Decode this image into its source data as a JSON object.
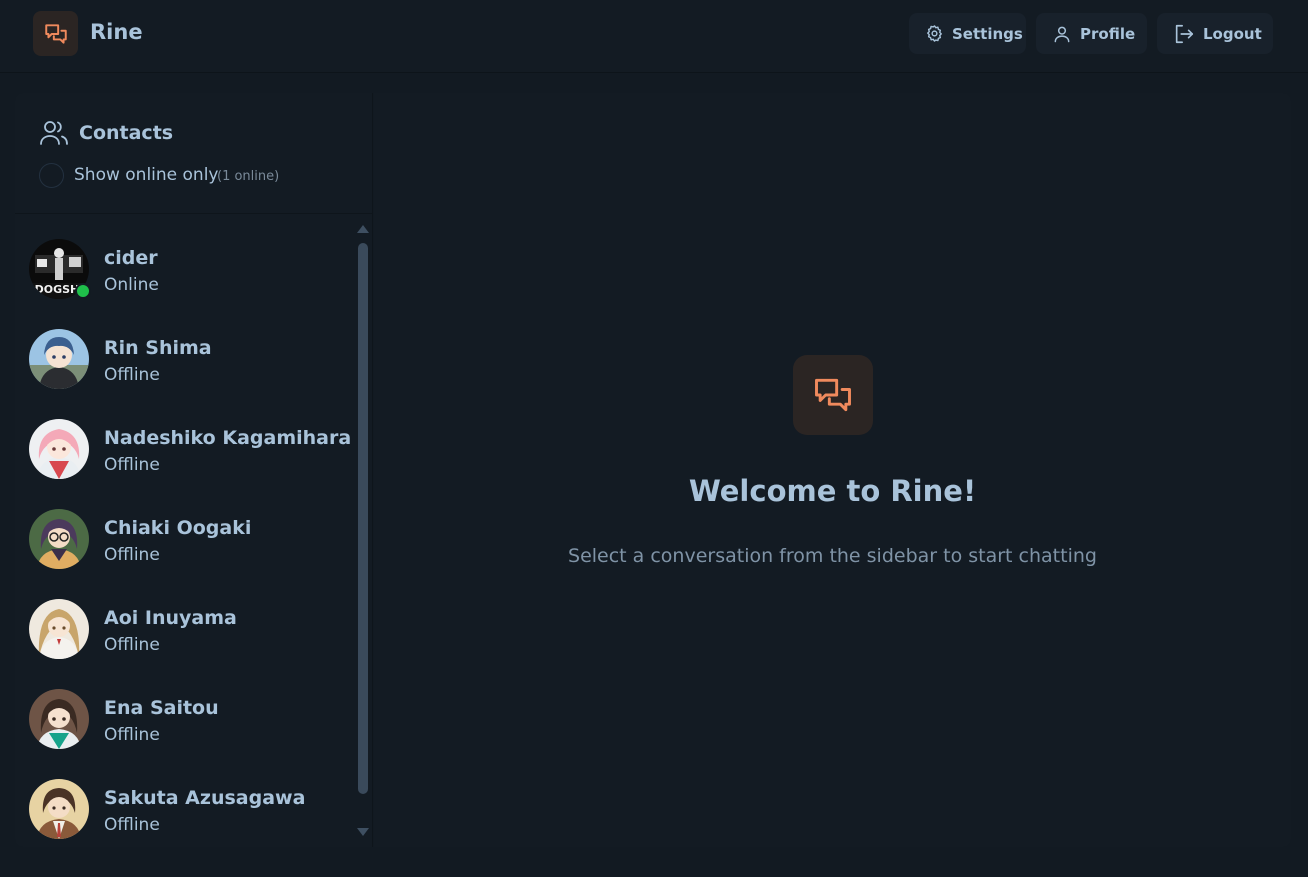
{
  "app": {
    "name": "Rine",
    "accent_color": "#f08a5d",
    "logo_icon": "chat-bubbles-icon"
  },
  "header": {
    "buttons": {
      "settings": {
        "label": "Settings",
        "icon": "gear-icon"
      },
      "profile": {
        "label": "Profile",
        "icon": "user-icon"
      },
      "logout": {
        "label": "Logout",
        "icon": "logout-icon"
      }
    }
  },
  "sidebar": {
    "title": "Contacts",
    "title_icon": "users-icon",
    "filter_label": "Show online only",
    "online_count": "(1 online)",
    "filter_checked": false,
    "contacts": [
      {
        "name": "cider",
        "status": "Online",
        "online": true
      },
      {
        "name": "Rin Shima",
        "status": "Offline",
        "online": false
      },
      {
        "name": "Nadeshiko Kagamihara",
        "status": "Offline",
        "online": false
      },
      {
        "name": "Chiaki Oogaki",
        "status": "Offline",
        "online": false
      },
      {
        "name": "Aoi Inuyama",
        "status": "Offline",
        "online": false
      },
      {
        "name": "Ena Saitou",
        "status": "Offline",
        "online": false
      },
      {
        "name": "Sakuta Azusagawa",
        "status": "Offline",
        "online": false
      }
    ]
  },
  "main": {
    "welcome_title": "Welcome to Rine!",
    "welcome_subtitle": "Select a conversation from the sidebar to start chatting"
  }
}
